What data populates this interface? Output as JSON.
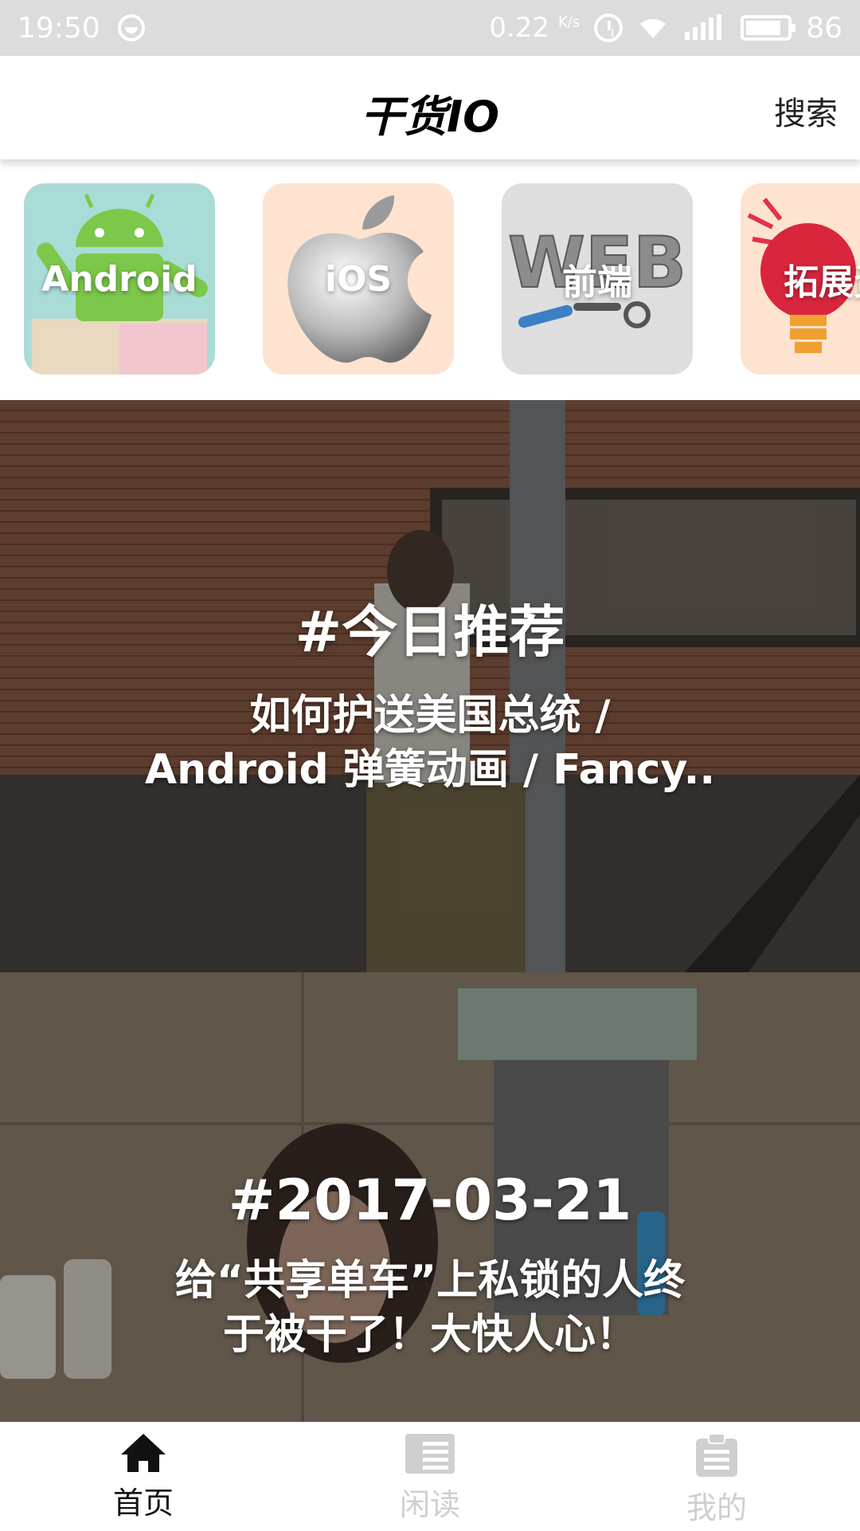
{
  "status_bar": {
    "time": "19:50",
    "speed": "0.22",
    "speed_unit": "K/s",
    "battery": "86"
  },
  "header": {
    "title": "干货IO",
    "search_label": "搜索"
  },
  "categories": [
    {
      "label": "Android"
    },
    {
      "label": "iOS"
    },
    {
      "label": "前端"
    },
    {
      "label": "拓展资"
    }
  ],
  "feed": [
    {
      "tag": "#今日推荐",
      "desc_line1": "如何护送美国总统 /",
      "desc_line2": "Android 弹簧动画 / Fancy.."
    },
    {
      "tag": "#2017-03-21",
      "desc_line1": "给“共享单车”上私锁的人终",
      "desc_line2": "于被干了！大快人心！"
    }
  ],
  "bottom_nav": [
    {
      "label": "首页",
      "icon": "home-icon",
      "active": true
    },
    {
      "label": "闲读",
      "icon": "book-icon",
      "active": false
    },
    {
      "label": "我的",
      "icon": "clipboard-icon",
      "active": false
    }
  ],
  "colors": {
    "active_tab": "#111111",
    "inactive_tab": "#cfcfcf"
  }
}
